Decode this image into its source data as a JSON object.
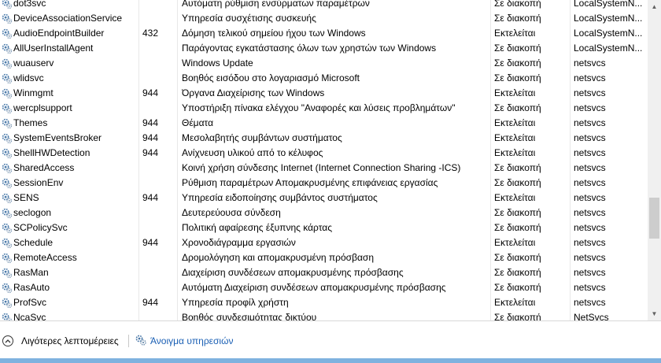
{
  "services": [
    {
      "name": "dot3svc",
      "pid": "",
      "description": "Αυτόματη ρύθμιση ενσύρματων παραμέτρων",
      "status": "Σε διακοπή",
      "group": "LocalSystemN..."
    },
    {
      "name": "DeviceAssociationService",
      "pid": "",
      "description": "Υπηρεσία συσχέτισης συσκευής",
      "status": "Σε διακοπή",
      "group": "LocalSystemN..."
    },
    {
      "name": "AudioEndpointBuilder",
      "pid": "432",
      "description": "Δόμηση τελικού σημείου ήχου των Windows",
      "status": "Εκτελείται",
      "group": "LocalSystemN..."
    },
    {
      "name": "AllUserInstallAgent",
      "pid": "",
      "description": "Παράγοντας εγκατάστασης όλων των χρηστών των Windows",
      "status": "Σε διακοπή",
      "group": "LocalSystemN..."
    },
    {
      "name": "wuauserv",
      "pid": "",
      "description": "Windows Update",
      "status": "Σε διακοπή",
      "group": "netsvcs"
    },
    {
      "name": "wlidsvc",
      "pid": "",
      "description": "Βοηθός εισόδου στο λογαριασμό Microsoft",
      "status": "Σε διακοπή",
      "group": "netsvcs"
    },
    {
      "name": "Winmgmt",
      "pid": "944",
      "description": "Όργανα Διαχείρισης των Windows",
      "status": "Εκτελείται",
      "group": "netsvcs"
    },
    {
      "name": "wercplsupport",
      "pid": "",
      "description": "Υποστήριξη πίνακα ελέγχου \"Αναφορές και λύσεις προβλημάτων\"",
      "status": "Σε διακοπή",
      "group": "netsvcs"
    },
    {
      "name": "Themes",
      "pid": "944",
      "description": "Θέματα",
      "status": "Εκτελείται",
      "group": "netsvcs"
    },
    {
      "name": "SystemEventsBroker",
      "pid": "944",
      "description": "Μεσολαβητής συμβάντων συστήματος",
      "status": "Εκτελείται",
      "group": "netsvcs"
    },
    {
      "name": "ShellHWDetection",
      "pid": "944",
      "description": "Ανίχνευση υλικού από το κέλυφος",
      "status": "Εκτελείται",
      "group": "netsvcs"
    },
    {
      "name": "SharedAccess",
      "pid": "",
      "description": "Κοινή χρήση σύνδεσης Internet (Internet Connection Sharing -ICS)",
      "status": "Σε διακοπή",
      "group": "netsvcs"
    },
    {
      "name": "SessionEnv",
      "pid": "",
      "description": "Ρύθμιση παραμέτρων Απομακρυσμένης επιφάνειας εργασίας",
      "status": "Σε διακοπή",
      "group": "netsvcs"
    },
    {
      "name": "SENS",
      "pid": "944",
      "description": "Υπηρεσία ειδοποίησης συμβάντος συστήματος",
      "status": "Εκτελείται",
      "group": "netsvcs"
    },
    {
      "name": "seclogon",
      "pid": "",
      "description": "Δευτερεύουσα σύνδεση",
      "status": "Σε διακοπή",
      "group": "netsvcs"
    },
    {
      "name": "SCPolicySvc",
      "pid": "",
      "description": "Πολιτική αφαίρεσης έξυπνης κάρτας",
      "status": "Σε διακοπή",
      "group": "netsvcs"
    },
    {
      "name": "Schedule",
      "pid": "944",
      "description": "Χρονοδιάγραμμα εργασιών",
      "status": "Εκτελείται",
      "group": "netsvcs"
    },
    {
      "name": "RemoteAccess",
      "pid": "",
      "description": "Δρομολόγηση και απομακρυσμένη πρόσβαση",
      "status": "Σε διακοπή",
      "group": "netsvcs"
    },
    {
      "name": "RasMan",
      "pid": "",
      "description": "Διαχείριση συνδέσεων απομακρυσμένης πρόσβασης",
      "status": "Σε διακοπή",
      "group": "netsvcs"
    },
    {
      "name": "RasAuto",
      "pid": "",
      "description": "Αυτόματη Διαχείριση συνδέσεων απομακρυσμένης πρόσβασης",
      "status": "Σε διακοπή",
      "group": "netsvcs"
    },
    {
      "name": "ProfSvc",
      "pid": "944",
      "description": "Υπηρεσία προφίλ χρήστη",
      "status": "Εκτελείται",
      "group": "netsvcs"
    },
    {
      "name": "NcaSvc",
      "pid": "",
      "description": "Βοηθός συνδεσιμότητας δικτύου",
      "status": "Σε διακοπή",
      "group": "NetSvcs"
    }
  ],
  "footer": {
    "fewer_details_label": "Λιγότερες λεπτομέρειες",
    "open_services_label": "Άνοιγμα υπηρεσιών"
  },
  "colors": {
    "link": "#1a5fb4",
    "bottom_strip": "#7fb2df"
  },
  "icons": {
    "service_row": "gear-icon",
    "fewer_details": "chevron-up-circle-icon",
    "open_services": "gears-icon"
  }
}
